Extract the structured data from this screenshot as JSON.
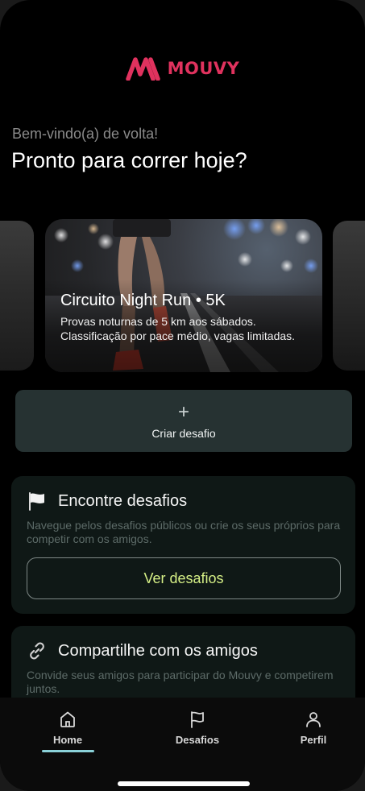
{
  "brand": {
    "name": "MOUVY",
    "color": "#e0325e"
  },
  "greeting": {
    "welcome": "Bem-vindo(a) de volta!",
    "headline": "Pronto para correr hoje?"
  },
  "carousel": {
    "active_card": {
      "title": "Circuito Night Run • 5K",
      "description": "Provas noturnas de 5 km aos sábados. Classificação por pace médio, vagas limitadas."
    }
  },
  "create_challenge": {
    "icon": "plus-icon",
    "label": "Criar desafio"
  },
  "find_challenges": {
    "icon": "flag-icon",
    "title": "Encontre desafios",
    "description": "Navegue pelos desafios públicos ou crie os seus próprios para competir com os amigos.",
    "button_label": "Ver desafios"
  },
  "share": {
    "icon": "link-icon",
    "title": "Compartilhe com os amigos",
    "description": "Convide seus amigos para participar do Mouvy e competirem juntos."
  },
  "tabbar": {
    "active": "Home",
    "items": [
      {
        "label": "Home",
        "icon": "home-icon"
      },
      {
        "label": "Desafios",
        "icon": "flag-icon"
      },
      {
        "label": "Perfil",
        "icon": "user-icon"
      }
    ]
  },
  "colors": {
    "accent_button_text": "#d5ef86",
    "tab_indicator": "#8ad1d8",
    "create_button_bg": "#263232",
    "panel_bg": "#0f1816"
  }
}
